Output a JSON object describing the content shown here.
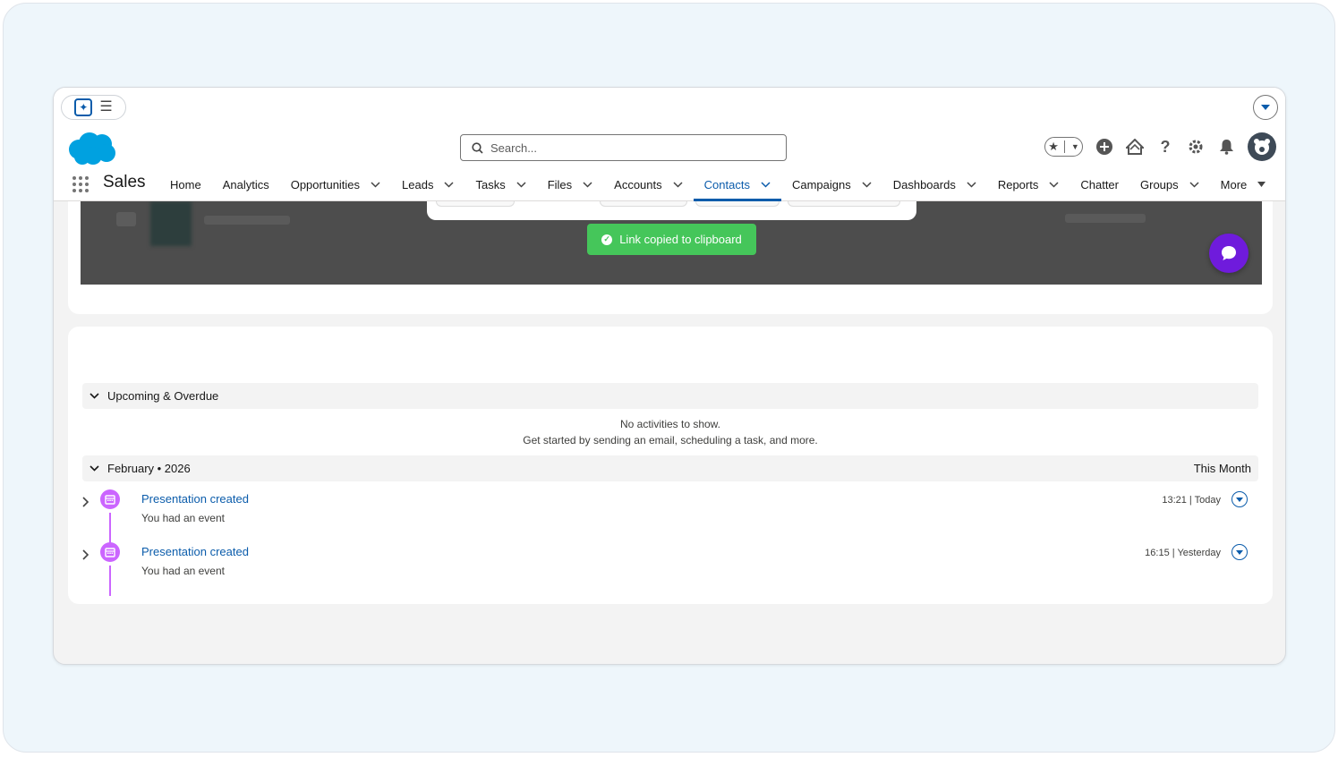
{
  "topbar": {
    "ai_icon": "sparkle-icon",
    "menu_icon": "hamburger-icon",
    "dropdown_icon": "chevron-down-icon"
  },
  "header": {
    "search_placeholder": "Search...",
    "icons": [
      "favorites-star-icon",
      "add-icon",
      "trailhead-icon",
      "help-icon",
      "settings-gear-icon",
      "notifications-bell-icon",
      "avatar"
    ]
  },
  "nav": {
    "app_name": "Sales",
    "items": [
      {
        "label": "Home",
        "dropdown": false,
        "active": false
      },
      {
        "label": "Analytics",
        "dropdown": false,
        "active": false
      },
      {
        "label": "Opportunities",
        "dropdown": true,
        "active": false
      },
      {
        "label": "Leads",
        "dropdown": true,
        "active": false
      },
      {
        "label": "Tasks",
        "dropdown": true,
        "active": false
      },
      {
        "label": "Files",
        "dropdown": true,
        "active": false
      },
      {
        "label": "Accounts",
        "dropdown": true,
        "active": false
      },
      {
        "label": "Contacts",
        "dropdown": true,
        "active": true
      },
      {
        "label": "Campaigns",
        "dropdown": true,
        "active": false
      },
      {
        "label": "Dashboards",
        "dropdown": true,
        "active": false
      },
      {
        "label": "Reports",
        "dropdown": true,
        "active": false
      },
      {
        "label": "Chatter",
        "dropdown": false,
        "active": false
      },
      {
        "label": "Groups",
        "dropdown": true,
        "active": false
      },
      {
        "label": "More",
        "dropdown": true,
        "active": false
      }
    ]
  },
  "toast": {
    "message": "Link copied to clipboard",
    "color": "#45c65a"
  },
  "activity": {
    "upcoming_label": "Upcoming & Overdue",
    "empty_line1": "No activities to show.",
    "empty_line2": "Get started by sending an email, scheduling a task, and more.",
    "month_label": "February • 2026",
    "month_right": "This Month",
    "events": [
      {
        "title": "Presentation created",
        "subtitle": "You had an event",
        "time": "13:21 | Today"
      },
      {
        "title": "Presentation created",
        "subtitle": "You had an event",
        "time": "16:15 | Yesterday"
      }
    ]
  },
  "colors": {
    "brand_blue": "#0b5cab",
    "event_purple": "#cb65ff",
    "chat_purple": "#6f1bdc",
    "salesforce_cloud": "#00a1e0"
  }
}
